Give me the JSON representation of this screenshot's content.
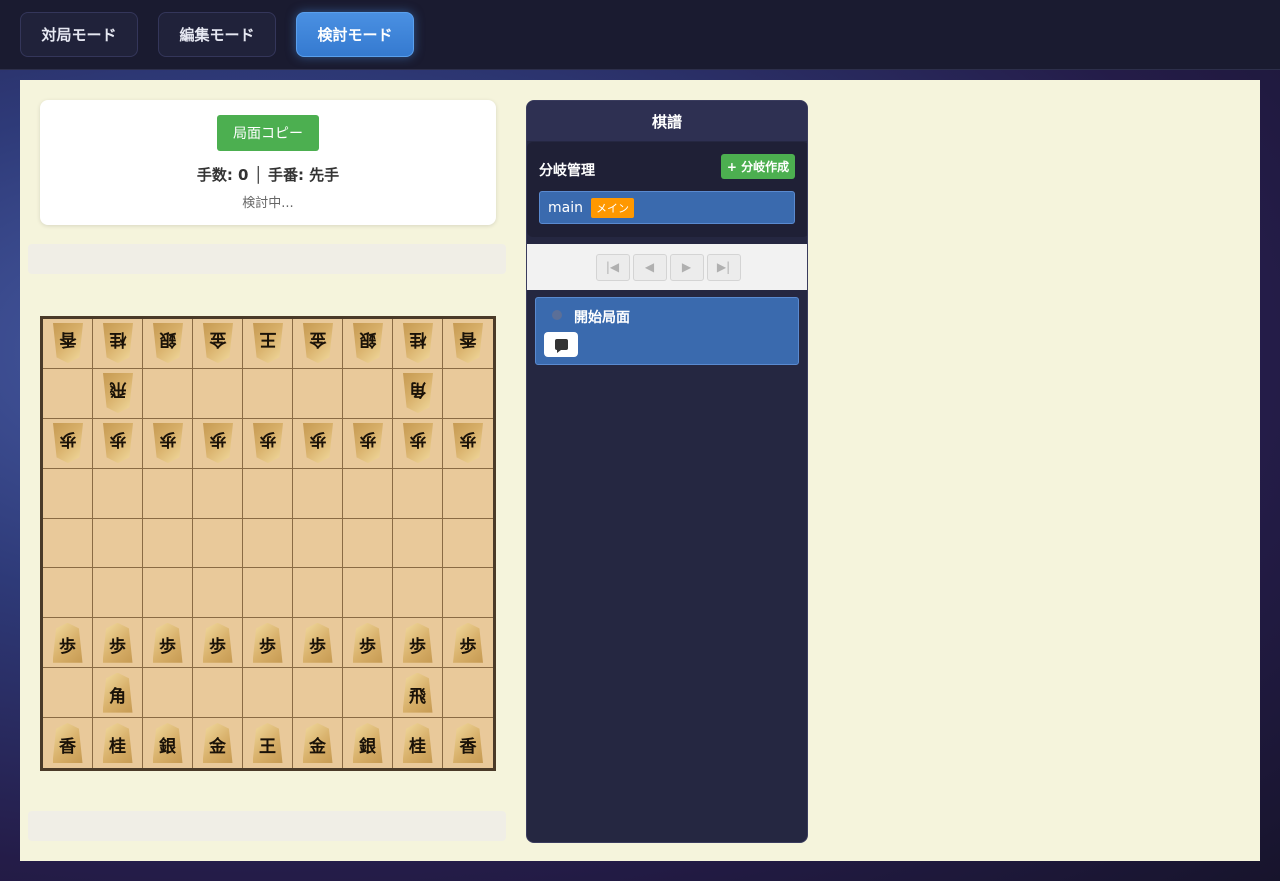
{
  "modes": [
    {
      "label": "対局モード",
      "active": false
    },
    {
      "label": "編集モード",
      "active": false
    },
    {
      "label": "検討モード",
      "active": true
    }
  ],
  "info": {
    "copy_label": "局面コピー",
    "status": "手数: 0 │ 手番: 先手",
    "sub_status": "検討中..."
  },
  "board": {
    "rows": [
      [
        "-香",
        "-桂",
        "-銀",
        "-金",
        "-王",
        "-金",
        "-銀",
        "-桂",
        "-香"
      ],
      [
        "",
        "-飛",
        "",
        "",
        "",
        "",
        "",
        "-角",
        ""
      ],
      [
        "-歩",
        "-歩",
        "-歩",
        "-歩",
        "-歩",
        "-歩",
        "-歩",
        "-歩",
        "-歩"
      ],
      [
        "",
        "",
        "",
        "",
        "",
        "",
        "",
        "",
        ""
      ],
      [
        "",
        "",
        "",
        "",
        "",
        "",
        "",
        "",
        ""
      ],
      [
        "",
        "",
        "",
        "",
        "",
        "",
        "",
        "",
        ""
      ],
      [
        "+歩",
        "+歩",
        "+歩",
        "+歩",
        "+歩",
        "+歩",
        "+歩",
        "+歩",
        "+歩"
      ],
      [
        "",
        "+角",
        "",
        "",
        "",
        "",
        "",
        "+飛",
        ""
      ],
      [
        "+香",
        "+桂",
        "+銀",
        "+金",
        "+王",
        "+金",
        "+銀",
        "+桂",
        "+香"
      ]
    ]
  },
  "kifu": {
    "title": "棋譜",
    "branch_header": "分岐管理",
    "branch_add": "+ 分岐作成",
    "branches": [
      {
        "name": "main",
        "badge": "メイン"
      }
    ],
    "nav": [
      "|◀",
      "◀",
      "▶",
      "▶|"
    ],
    "moves": [
      {
        "label": "開始局面"
      }
    ]
  }
}
